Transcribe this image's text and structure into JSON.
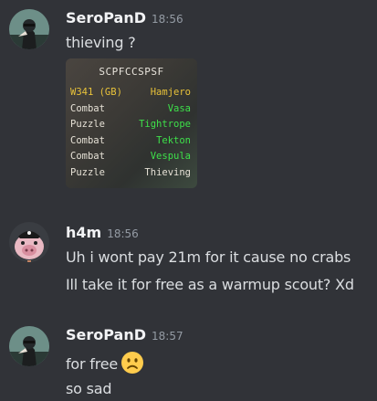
{
  "messages": [
    {
      "username": "SeroPanD",
      "timestamp": "18:56",
      "text": "thieving ?",
      "attachment": {
        "title": "SCPFCCSPSF",
        "rows": [
          {
            "left": "W341 (GB)",
            "right": "Hamjero",
            "left_color": "#e8c23a",
            "right_color": "#e8c23a"
          },
          {
            "left": "Combat",
            "right": "Vasa",
            "left_color": "#e6e1d6",
            "right_color": "#3ee04a"
          },
          {
            "left": "Puzzle",
            "right": "Tightrope",
            "left_color": "#e6e1d6",
            "right_color": "#3ee04a"
          },
          {
            "left": "Combat",
            "right": "Tekton",
            "left_color": "#e6e1d6",
            "right_color": "#3ee04a"
          },
          {
            "left": "Combat",
            "right": "Vespula",
            "left_color": "#e6e1d6",
            "right_color": "#3ee04a"
          },
          {
            "left": "Puzzle",
            "right": "Thieving",
            "left_color": "#e6e1d6",
            "right_color": "#e6e1d6"
          }
        ]
      }
    },
    {
      "username": "h4m",
      "timestamp": "18:56",
      "lines": [
        "Uh i wont pay 21m for it cause no crabs",
        "Ill take it for free as a warmup scout? Xd"
      ]
    },
    {
      "username": "SeroPanD",
      "timestamp": "18:57",
      "lines": [
        "for free",
        "so sad"
      ],
      "emoji": "slightly-frowning-face-emoji"
    }
  ],
  "colors": {
    "background": "#313338",
    "username": "#f2f3f5",
    "timestamp": "#949ba4",
    "text": "#dbdee1"
  }
}
